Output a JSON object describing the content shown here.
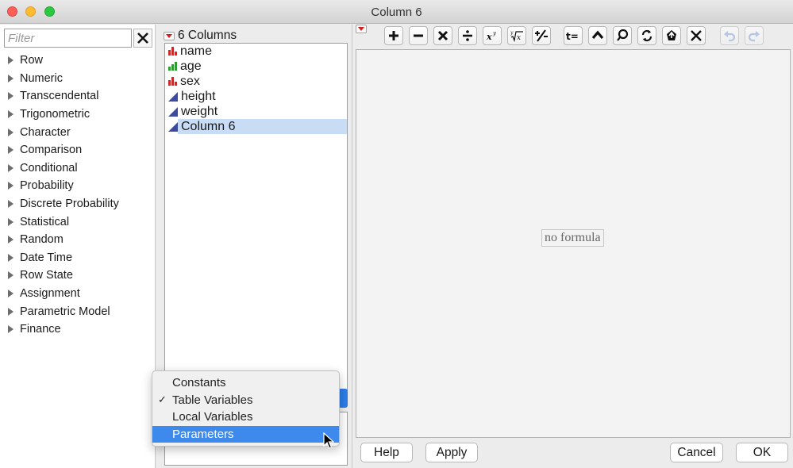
{
  "window": {
    "title": "Column 6"
  },
  "filter": {
    "placeholder": "Filter"
  },
  "categories": [
    "Row",
    "Numeric",
    "Transcendental",
    "Trigonometric",
    "Character",
    "Comparison",
    "Conditional",
    "Probability",
    "Discrete Probability",
    "Statistical",
    "Random",
    "Date Time",
    "Row State",
    "Assignment",
    "Parametric Model",
    "Finance"
  ],
  "columns": {
    "header": "6 Columns",
    "items": [
      {
        "label": "name",
        "icon": "nominal-icon"
      },
      {
        "label": "age",
        "icon": "ordinal-icon"
      },
      {
        "label": "sex",
        "icon": "nominal-icon"
      },
      {
        "label": "height",
        "icon": "continuous-icon"
      },
      {
        "label": "weight",
        "icon": "continuous-icon"
      },
      {
        "label": "Column 6",
        "icon": "continuous-icon",
        "selected": true
      }
    ]
  },
  "dropdown": {
    "items": [
      {
        "label": "Constants",
        "checked": false
      },
      {
        "label": "Table Variables",
        "checked": true
      },
      {
        "label": "Local Variables",
        "checked": false
      },
      {
        "label": "Parameters",
        "highlighted": true
      }
    ],
    "check_glyph": "✓"
  },
  "toolbar": {
    "buttons": [
      "add-icon",
      "subtract-icon",
      "multiply-icon",
      "divide-icon",
      "power-icon",
      "root-icon",
      "negate-icon",
      "assign-icon",
      "raise-icon",
      "local-icon",
      "swap-icon",
      "peel-icon",
      "delete-icon",
      "undo-icon",
      "redo-icon"
    ]
  },
  "formula": {
    "empty_text": "no formula"
  },
  "buttons": {
    "help": "Help",
    "apply": "Apply",
    "cancel": "Cancel",
    "ok": "OK"
  },
  "colors": {
    "selection": "#c9dcf5",
    "menu_highlight": "#3e89ec",
    "close": "#fc5f57",
    "minimize": "#fdbc2e",
    "zoom": "#2ac940"
  }
}
